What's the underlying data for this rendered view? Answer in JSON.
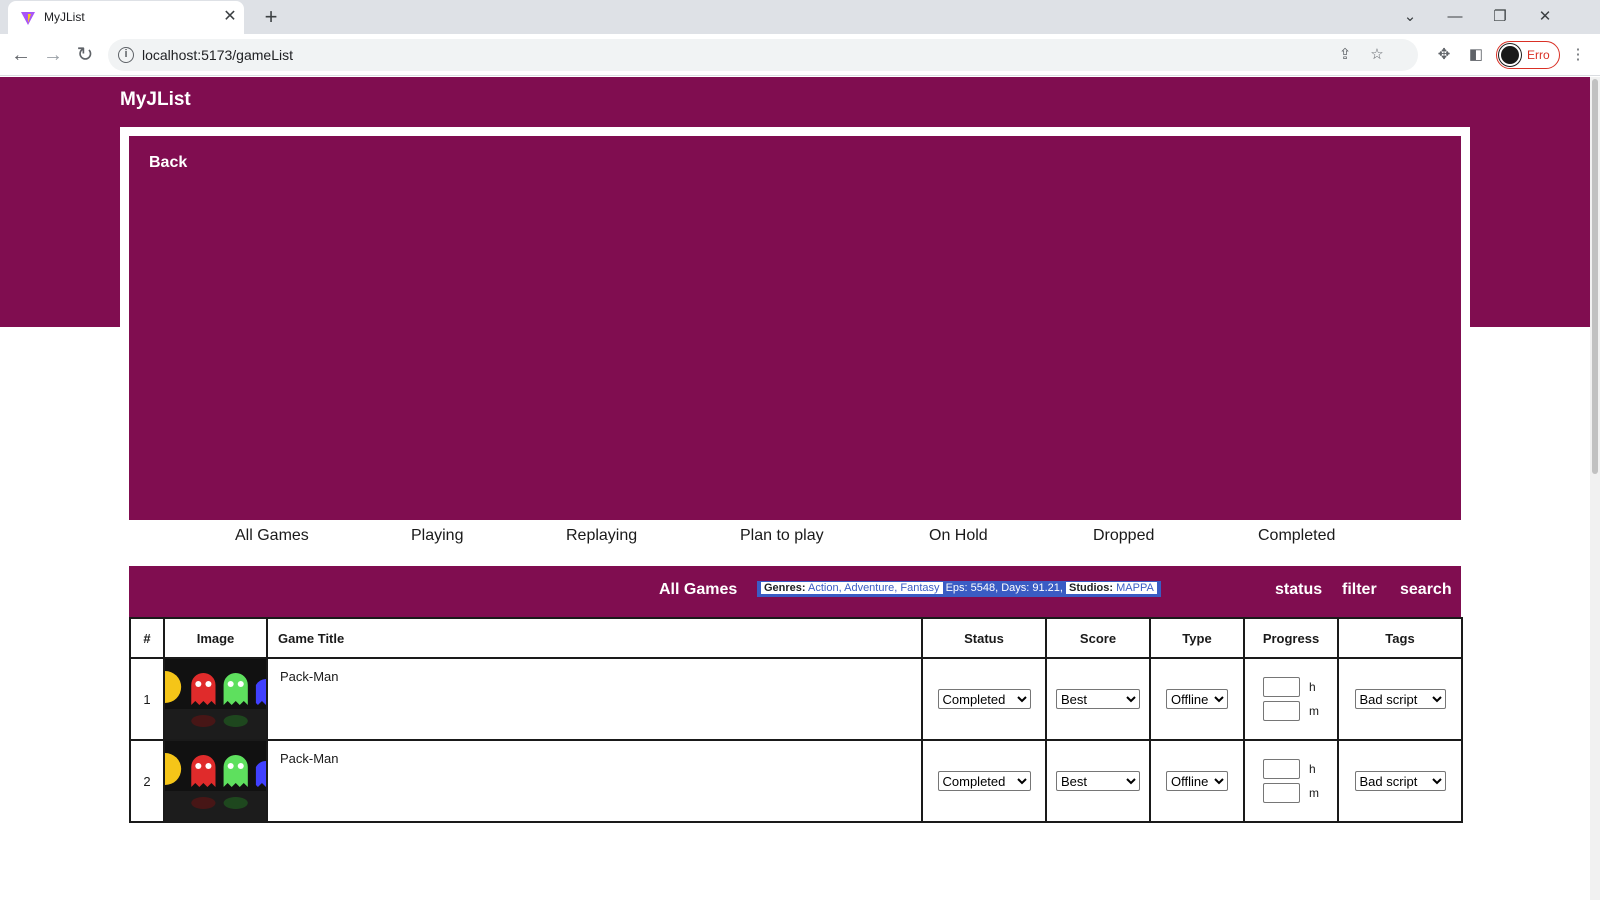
{
  "browser": {
    "tab_title": "MyJList",
    "tab_close": "✕",
    "new_tab": "+",
    "url": "localhost:5173/gameList",
    "profile_label": "Erro",
    "window_controls": {
      "dropdown": "⌄",
      "minimize": "—",
      "restore": "❐",
      "close": "✕"
    },
    "nav": {
      "back": "←",
      "forward": "→",
      "reload": "↻"
    }
  },
  "site": {
    "brand": "MyJList",
    "back_label": "Back"
  },
  "status_tabs": [
    "All Games",
    "Playing",
    "Replaying",
    "Plan to play",
    "On Hold",
    "Dropped",
    "Completed"
  ],
  "list_bar": {
    "title": "All Games",
    "genres_label": "Genres:",
    "genres_value": "Action, Adventure, Fantasy",
    "stats_text": "Eps: 5548, Days: 91.21,",
    "studios_label": "Studios:",
    "studios_value": "MAPPA",
    "links": [
      "status",
      "filter",
      "search"
    ]
  },
  "table": {
    "headers": {
      "index": "#",
      "image": "Image",
      "title": "Game Title",
      "status": "Status",
      "score": "Score",
      "type": "Type",
      "progress": "Progress",
      "tags": "Tags"
    },
    "progress_units": {
      "hours": "h",
      "minutes": "m"
    },
    "rows": [
      {
        "index": "1",
        "title": "Pack-Man",
        "status": "Completed",
        "score": "Best",
        "type": "Offline",
        "tags": "Bad script"
      },
      {
        "index": "2",
        "title": "Pack-Man",
        "status": "Completed",
        "score": "Best",
        "type": "Offline",
        "tags": "Bad script"
      }
    ]
  },
  "colors": {
    "brand": "#800d50",
    "highlight": "#3a5cc4",
    "profile_accent": "#d93025"
  },
  "icons": [
    "info-icon",
    "share-icon",
    "star-icon",
    "extensions-icon",
    "sidebar-icon",
    "menu-icon",
    "vite-logo-icon"
  ]
}
